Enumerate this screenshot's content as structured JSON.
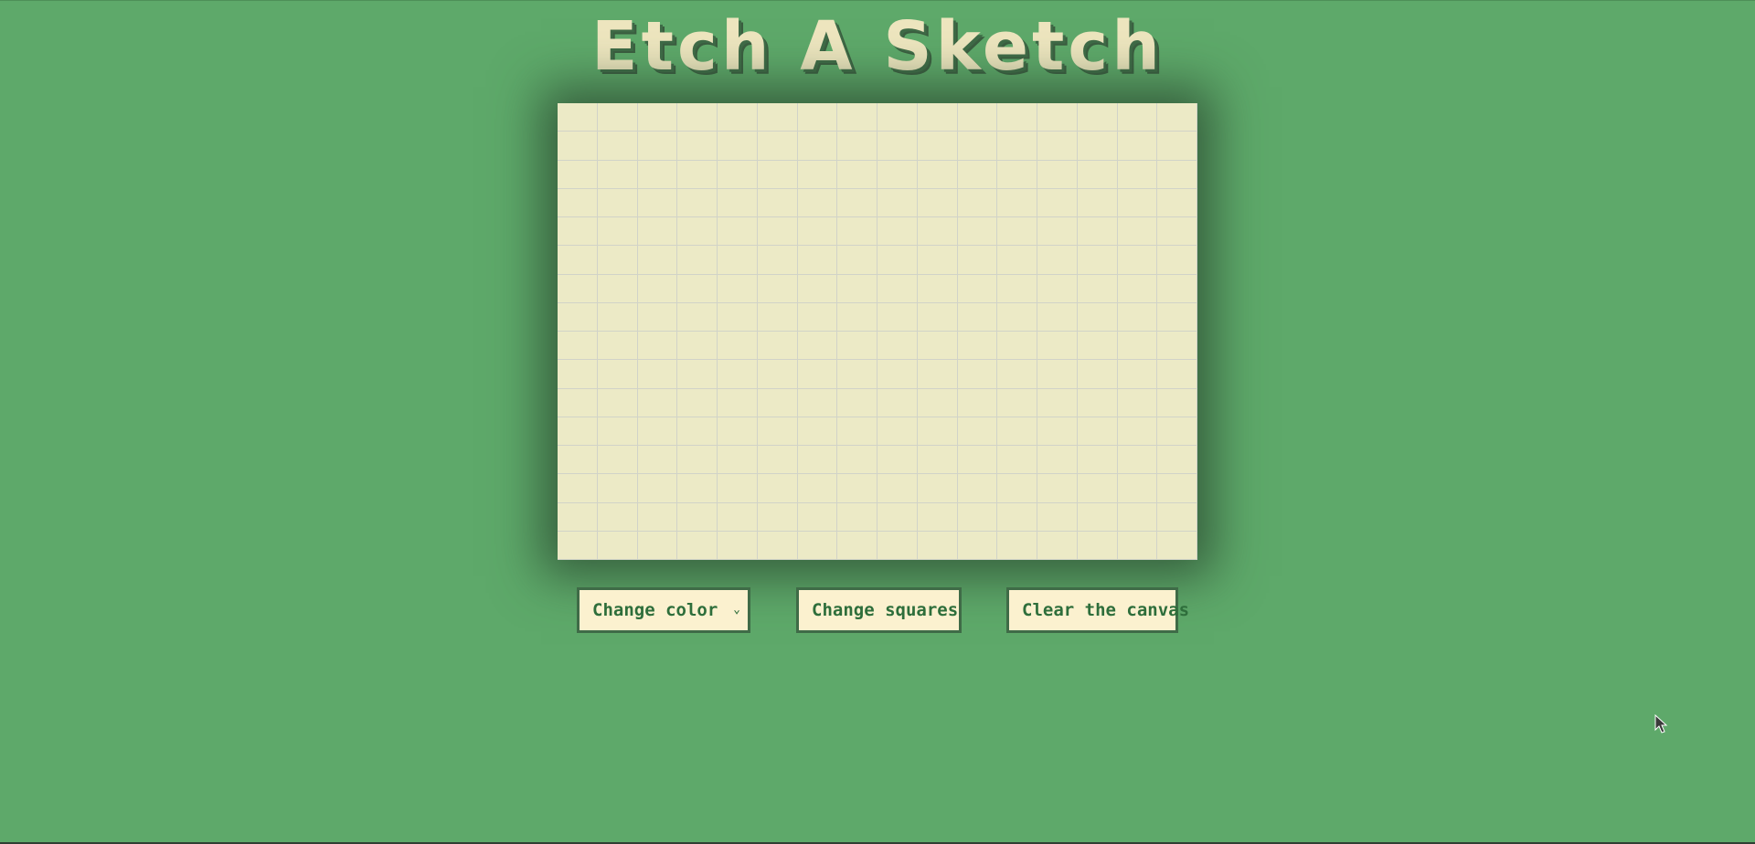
{
  "page": {
    "title": "Etch A Sketch",
    "background_color": "#5ea96a",
    "accent_color": "#3f6b47",
    "canvas_color": "#eceac6"
  },
  "canvas": {
    "rows": 16,
    "columns": 16
  },
  "controls": {
    "color_select": {
      "selected": "Change color",
      "icon": "chevron-down-icon"
    },
    "change_squares_label": "Change squares",
    "clear_label": "Clear the canvas"
  },
  "cursor": {
    "icon": "mouse-pointer-icon"
  }
}
